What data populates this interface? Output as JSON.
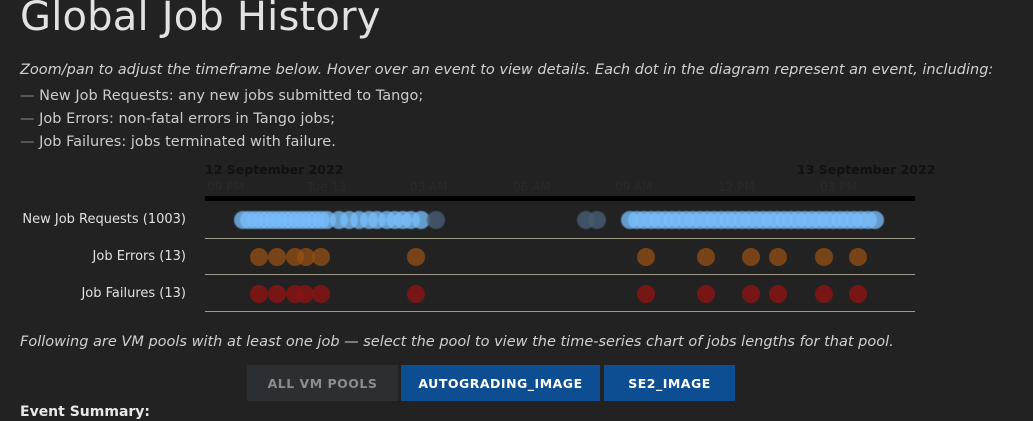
{
  "page": {
    "title": "Global Job History",
    "intro": "Zoom/pan to adjust the timeframe below. Hover over an event to view details. Each dot in the diagram represent an event, including:",
    "legend_items": [
      {
        "dash": "—",
        "text": "New Job Requests: any new jobs submitted to Tango;"
      },
      {
        "dash": "—",
        "text": "Job Errors: non-fatal errors in Tango jobs;"
      },
      {
        "dash": "—",
        "text": "Job Failures: jobs terminated with failure."
      }
    ]
  },
  "timeline": {
    "date_start": "12 September 2022",
    "date_end": "13 September 2022",
    "ticks": [
      "09 PM",
      "Tue 13",
      "03 AM",
      "06 AM",
      "09 AM",
      "12 PM",
      "03 PM"
    ],
    "rows": [
      {
        "label": "New Job Requests (1003)"
      },
      {
        "label": "Job Errors (13)"
      },
      {
        "label": "Job Failures (13)"
      }
    ],
    "colors": {
      "requests": "#78befa",
      "errors": "#965014",
      "failures": "#871414",
      "axis": "#000000"
    }
  },
  "pools": {
    "description": "Following are VM pools with at least one job — select the pool to view the time-series chart of jobs lengths for that pool.",
    "buttons": [
      {
        "label": "ALL VM POOLS",
        "state": "inactive"
      },
      {
        "label": "AUTOGRADING_IMAGE",
        "state": "active"
      },
      {
        "label": "SE2_IMAGE",
        "state": "active"
      }
    ]
  },
  "summary": {
    "heading": "Event Summary:"
  }
}
